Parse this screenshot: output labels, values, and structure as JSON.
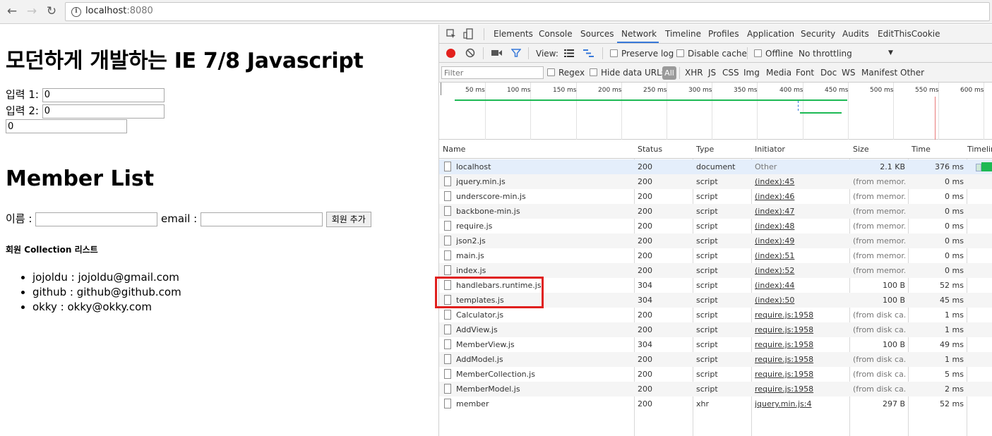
{
  "browser": {
    "back_icon": "back-arrow-icon",
    "forward_icon": "forward-arrow-icon",
    "reload_icon": "reload-icon",
    "url_host": "localhost",
    "url_port": ":8080"
  },
  "page": {
    "title": "모던하게 개발하는 IE 7/8 Javascript",
    "input1_label": "입력 1:",
    "input1_value": "0",
    "input2_label": "입력 2:",
    "input2_value": "0",
    "result_value": "0",
    "member_heading": "Member List",
    "name_label": "이름 :",
    "email_label": "email :",
    "add_button": "회원 추가",
    "collection_heading": "회원 Collection 리스트",
    "members": [
      "jojoldu : jojoldu@gmail.com",
      "github : github@github.com",
      "okky : okky@okky.com"
    ]
  },
  "devtools": {
    "tabs": [
      "Elements",
      "Console",
      "Sources",
      "Network",
      "Timeline",
      "Profiles",
      "Application",
      "Security",
      "Audits",
      "EditThisCookie"
    ],
    "active_tab": "Network",
    "toolbar": {
      "view_label": "View:",
      "preserve_log": "Preserve log",
      "disable_cache": "Disable cache",
      "offline": "Offline",
      "throttling": "No throttling"
    },
    "filter_bar": {
      "filter_placeholder": "Filter",
      "regex": "Regex",
      "hide_data_urls": "Hide data URLs",
      "types": [
        "All",
        "XHR",
        "JS",
        "CSS",
        "Img",
        "Media",
        "Font",
        "Doc",
        "WS",
        "Manifest",
        "Other"
      ]
    },
    "overview_ticks": [
      "50 ms",
      "100 ms",
      "150 ms",
      "200 ms",
      "250 ms",
      "300 ms",
      "350 ms",
      "400 ms",
      "450 ms",
      "500 ms",
      "550 ms",
      "600 ms"
    ],
    "columns": [
      "Name",
      "Status",
      "Type",
      "Initiator",
      "Size",
      "Time",
      "Timeline"
    ],
    "requests": [
      {
        "name": "localhost",
        "status": "200",
        "type": "document",
        "initiator": "Other",
        "size": "2.1 KB",
        "time": "376 ms"
      },
      {
        "name": "jquery.min.js",
        "status": "200",
        "type": "script",
        "initiator": "(index):45",
        "size": "(from memor...",
        "time": "0 ms"
      },
      {
        "name": "underscore-min.js",
        "status": "200",
        "type": "script",
        "initiator": "(index):46",
        "size": "(from memor...",
        "time": "0 ms"
      },
      {
        "name": "backbone-min.js",
        "status": "200",
        "type": "script",
        "initiator": "(index):47",
        "size": "(from memor...",
        "time": "0 ms"
      },
      {
        "name": "require.js",
        "status": "200",
        "type": "script",
        "initiator": "(index):48",
        "size": "(from memor...",
        "time": "0 ms"
      },
      {
        "name": "json2.js",
        "status": "200",
        "type": "script",
        "initiator": "(index):49",
        "size": "(from memor...",
        "time": "0 ms"
      },
      {
        "name": "main.js",
        "status": "200",
        "type": "script",
        "initiator": "(index):51",
        "size": "(from memor...",
        "time": "0 ms"
      },
      {
        "name": "index.js",
        "status": "200",
        "type": "script",
        "initiator": "(index):52",
        "size": "(from memor...",
        "time": "0 ms"
      },
      {
        "name": "handlebars.runtime.js",
        "status": "304",
        "type": "script",
        "initiator": "(index):44",
        "size": "100 B",
        "time": "52 ms"
      },
      {
        "name": "templates.js",
        "status": "304",
        "type": "script",
        "initiator": "(index):50",
        "size": "100 B",
        "time": "45 ms"
      },
      {
        "name": "Calculator.js",
        "status": "200",
        "type": "script",
        "initiator": "require.js:1958",
        "size": "(from disk ca...",
        "time": "1 ms"
      },
      {
        "name": "AddView.js",
        "status": "200",
        "type": "script",
        "initiator": "require.js:1958",
        "size": "(from disk ca...",
        "time": "1 ms"
      },
      {
        "name": "MemberView.js",
        "status": "304",
        "type": "script",
        "initiator": "require.js:1958",
        "size": "100 B",
        "time": "49 ms"
      },
      {
        "name": "AddModel.js",
        "status": "200",
        "type": "script",
        "initiator": "require.js:1958",
        "size": "(from disk ca...",
        "time": "1 ms"
      },
      {
        "name": "MemberCollection.js",
        "status": "200",
        "type": "script",
        "initiator": "require.js:1958",
        "size": "(from disk ca...",
        "time": "5 ms"
      },
      {
        "name": "MemberModel.js",
        "status": "200",
        "type": "script",
        "initiator": "require.js:1958",
        "size": "(from disk ca...",
        "time": "2 ms"
      },
      {
        "name": "member",
        "status": "200",
        "type": "xhr",
        "initiator": "jquery.min.js:4",
        "size": "297 B",
        "time": "52 ms"
      }
    ],
    "colors": {
      "accent": "#3879d9",
      "record": "#e3211d",
      "waterfall_green": "#1db954",
      "highlight_box": "#e0201e"
    }
  }
}
